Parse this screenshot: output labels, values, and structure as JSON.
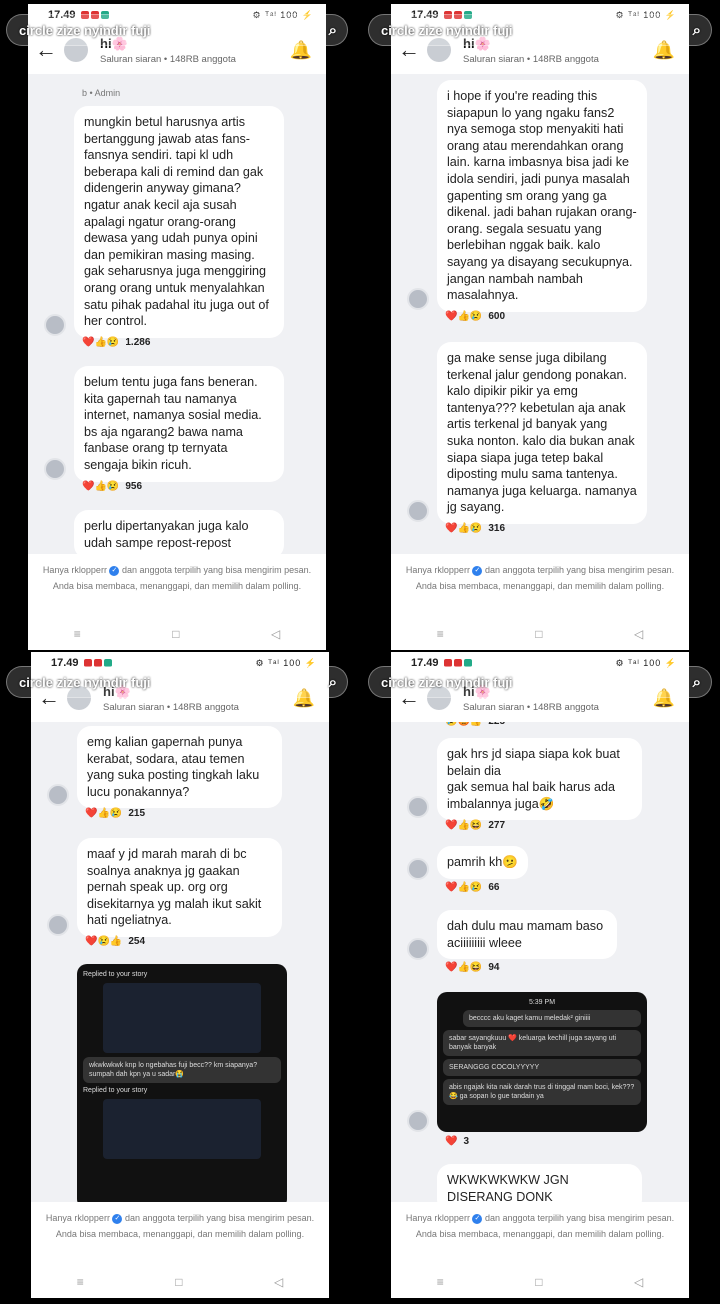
{
  "status": {
    "time": "17.49",
    "right": "⚙ ᵀᵃˡ 100 ⚡"
  },
  "header": {
    "title": "hi🌸",
    "subtitle": "Saluran siaran • 148RB anggota"
  },
  "overlay_text": "circle zize nyindir fuji",
  "notice": {
    "before": "Hanya rklopperr",
    "after": "dan anggota terpilih yang bisa mengirim pesan. Anda bisa membaca, menanggapi, dan memilih dalam polling."
  },
  "nav": {
    "recent": "≡",
    "home": "□",
    "back": "◁"
  },
  "panels": [
    {
      "admin": "b • Admin",
      "messages": [
        {
          "text": "mungkin betul harusnya artis bertanggung jawab atas fans-fansnya sendiri. tapi kl udh beberapa kali di remind dan gak didengerin anyway gimana? ngatur anak kecil aja susah apalagi ngatur orang-orang dewasa yang udah punya opini dan pemikiran masing masing. gak seharusnya juga menggiring orang orang untuk menyalahkan satu pihak padahal itu juga out of her control.",
          "reactions": "❤️👍😢",
          "count": "1.286"
        },
        {
          "text": "belum tentu juga fans beneran. kita gapernah tau namanya internet, namanya sosial media. bs aja ngarang2 bawa nama fanbase orang tp ternyata sengaja bikin ricuh.",
          "reactions": "❤️👍😢",
          "count": "956"
        },
        {
          "text": "perlu dipertanyakan juga kalo udah sampe repost-repost",
          "reactions": "",
          "count": ""
        }
      ]
    },
    {
      "messages": [
        {
          "text": "i hope if you're reading this siapapun lo yang ngaku fans2 nya semoga stop menyakiti hati orang atau merendahkan orang lain. karna imbasnya bisa jadi ke idola sendiri, jadi punya masalah gapenting sm orang yang ga dikenal. jadi bahan rujakan orang-orang. segala sesuatu yang berlebihan nggak baik. kalo sayang ya disayang secukupnya. jangan nambah nambah masalahnya.",
          "reactions": "❤️👍😢",
          "count": "600"
        },
        {
          "text": "ga make sense juga dibilang terkenal jalur gendong ponakan. kalo dipikir pikir ya emg tantenya??? kebetulan aja anak artis terkenal jd banyak yang suka nonton. kalo dia bukan anak siapa siapa juga tetep bakal diposting mulu sama tantenya. namanya juga keluarga. namanya jg sayang.",
          "reactions": "❤️👍😢",
          "count": "316"
        }
      ]
    },
    {
      "messages": [
        {
          "text": "emg kalian gapernah punya kerabat, sodara, atau temen yang suka posting tingkah laku lucu ponakannya?",
          "reactions": "❤️👍😢",
          "count": "215"
        },
        {
          "text": "maaf y jd marah marah di bc soalnya anaknya jg gaakan pernah speak up. org org disekitarnya yg malah ikut sakit hati ngeliatnya.",
          "reactions": "❤️😢👍",
          "count": "254"
        }
      ],
      "screenshot": {
        "replied": "Replied to your story",
        "reply_text": "wkwkwkwk knp lo ngebahas fuji becc?? km siapanya? sumpah dah kpn ya u sadar😭",
        "replied2": "Replied to your story"
      }
    },
    {
      "top_count": "225",
      "messages": [
        {
          "text": "gak hrs jd siapa siapa kok buat belain dia\ngak semua hal baik harus ada imbalannya juga🤣",
          "reactions": "❤️👍😆",
          "count": "277"
        },
        {
          "text": "pamrih kh🫤",
          "reactions": "❤️👍😢",
          "count": "66"
        },
        {
          "text": "dah dulu mau mamam baso aciiiiiiiii wleee",
          "reactions": "❤️👍😆",
          "count": "94"
        },
        {
          "text": "WKWKWKWKW JGN DISERANG DONK",
          "reactions": "",
          "count": ""
        }
      ],
      "screenshot": {
        "time": "5:39 PM",
        "m1": "becccc aku kaget kamu meledak² giniiii",
        "m2": "sabar sayangkuuu ❤️ keluarga kechill juga sayang uti banyak banyak",
        "m3": "SERANGGG COCOLYYYYY",
        "m4": "abis ngajak kita naik darah trus di tinggal mam boci, kek??? 😂 ga sopan lo gue tandain ya",
        "reactions": "❤️",
        "count": "3"
      }
    }
  ]
}
